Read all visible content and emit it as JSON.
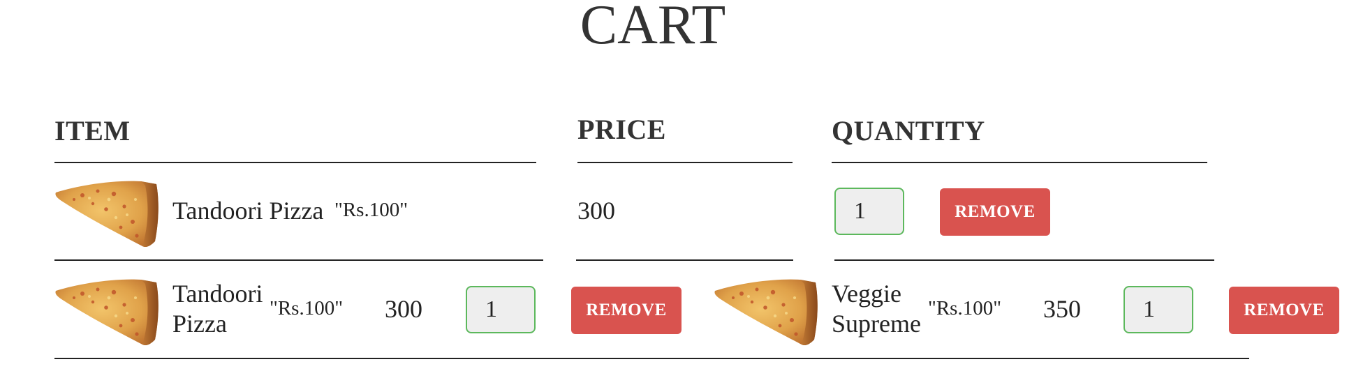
{
  "page": {
    "title": "CART"
  },
  "table": {
    "headers": {
      "item": "ITEM",
      "price": "PRICE",
      "quantity": "QUANTITY"
    }
  },
  "rows": [
    {
      "name": "Tandoori Pizza",
      "base_price": "\"Rs.100\"",
      "price": "300",
      "quantity": "1",
      "remove_label": "REMOVE",
      "image_icon": "pizza-slice"
    },
    {
      "name_line1": "Tandoori",
      "name_line2": "Pizza",
      "base_price": "\"Rs.100\"",
      "price": "300",
      "quantity": "1",
      "remove_label": "REMOVE",
      "image_icon": "pizza-slice"
    },
    {
      "name_line1": "Veggie",
      "name_line2": "Supreme",
      "base_price": "\"Rs.100\"",
      "price": "350",
      "quantity": "1",
      "remove_label": "REMOVE",
      "image_icon": "pizza-slice"
    }
  ],
  "colors": {
    "remove_button": "#d9534f",
    "quantity_border": "#5cb85c",
    "quantity_bg": "#eeeeee",
    "text": "#333333"
  }
}
